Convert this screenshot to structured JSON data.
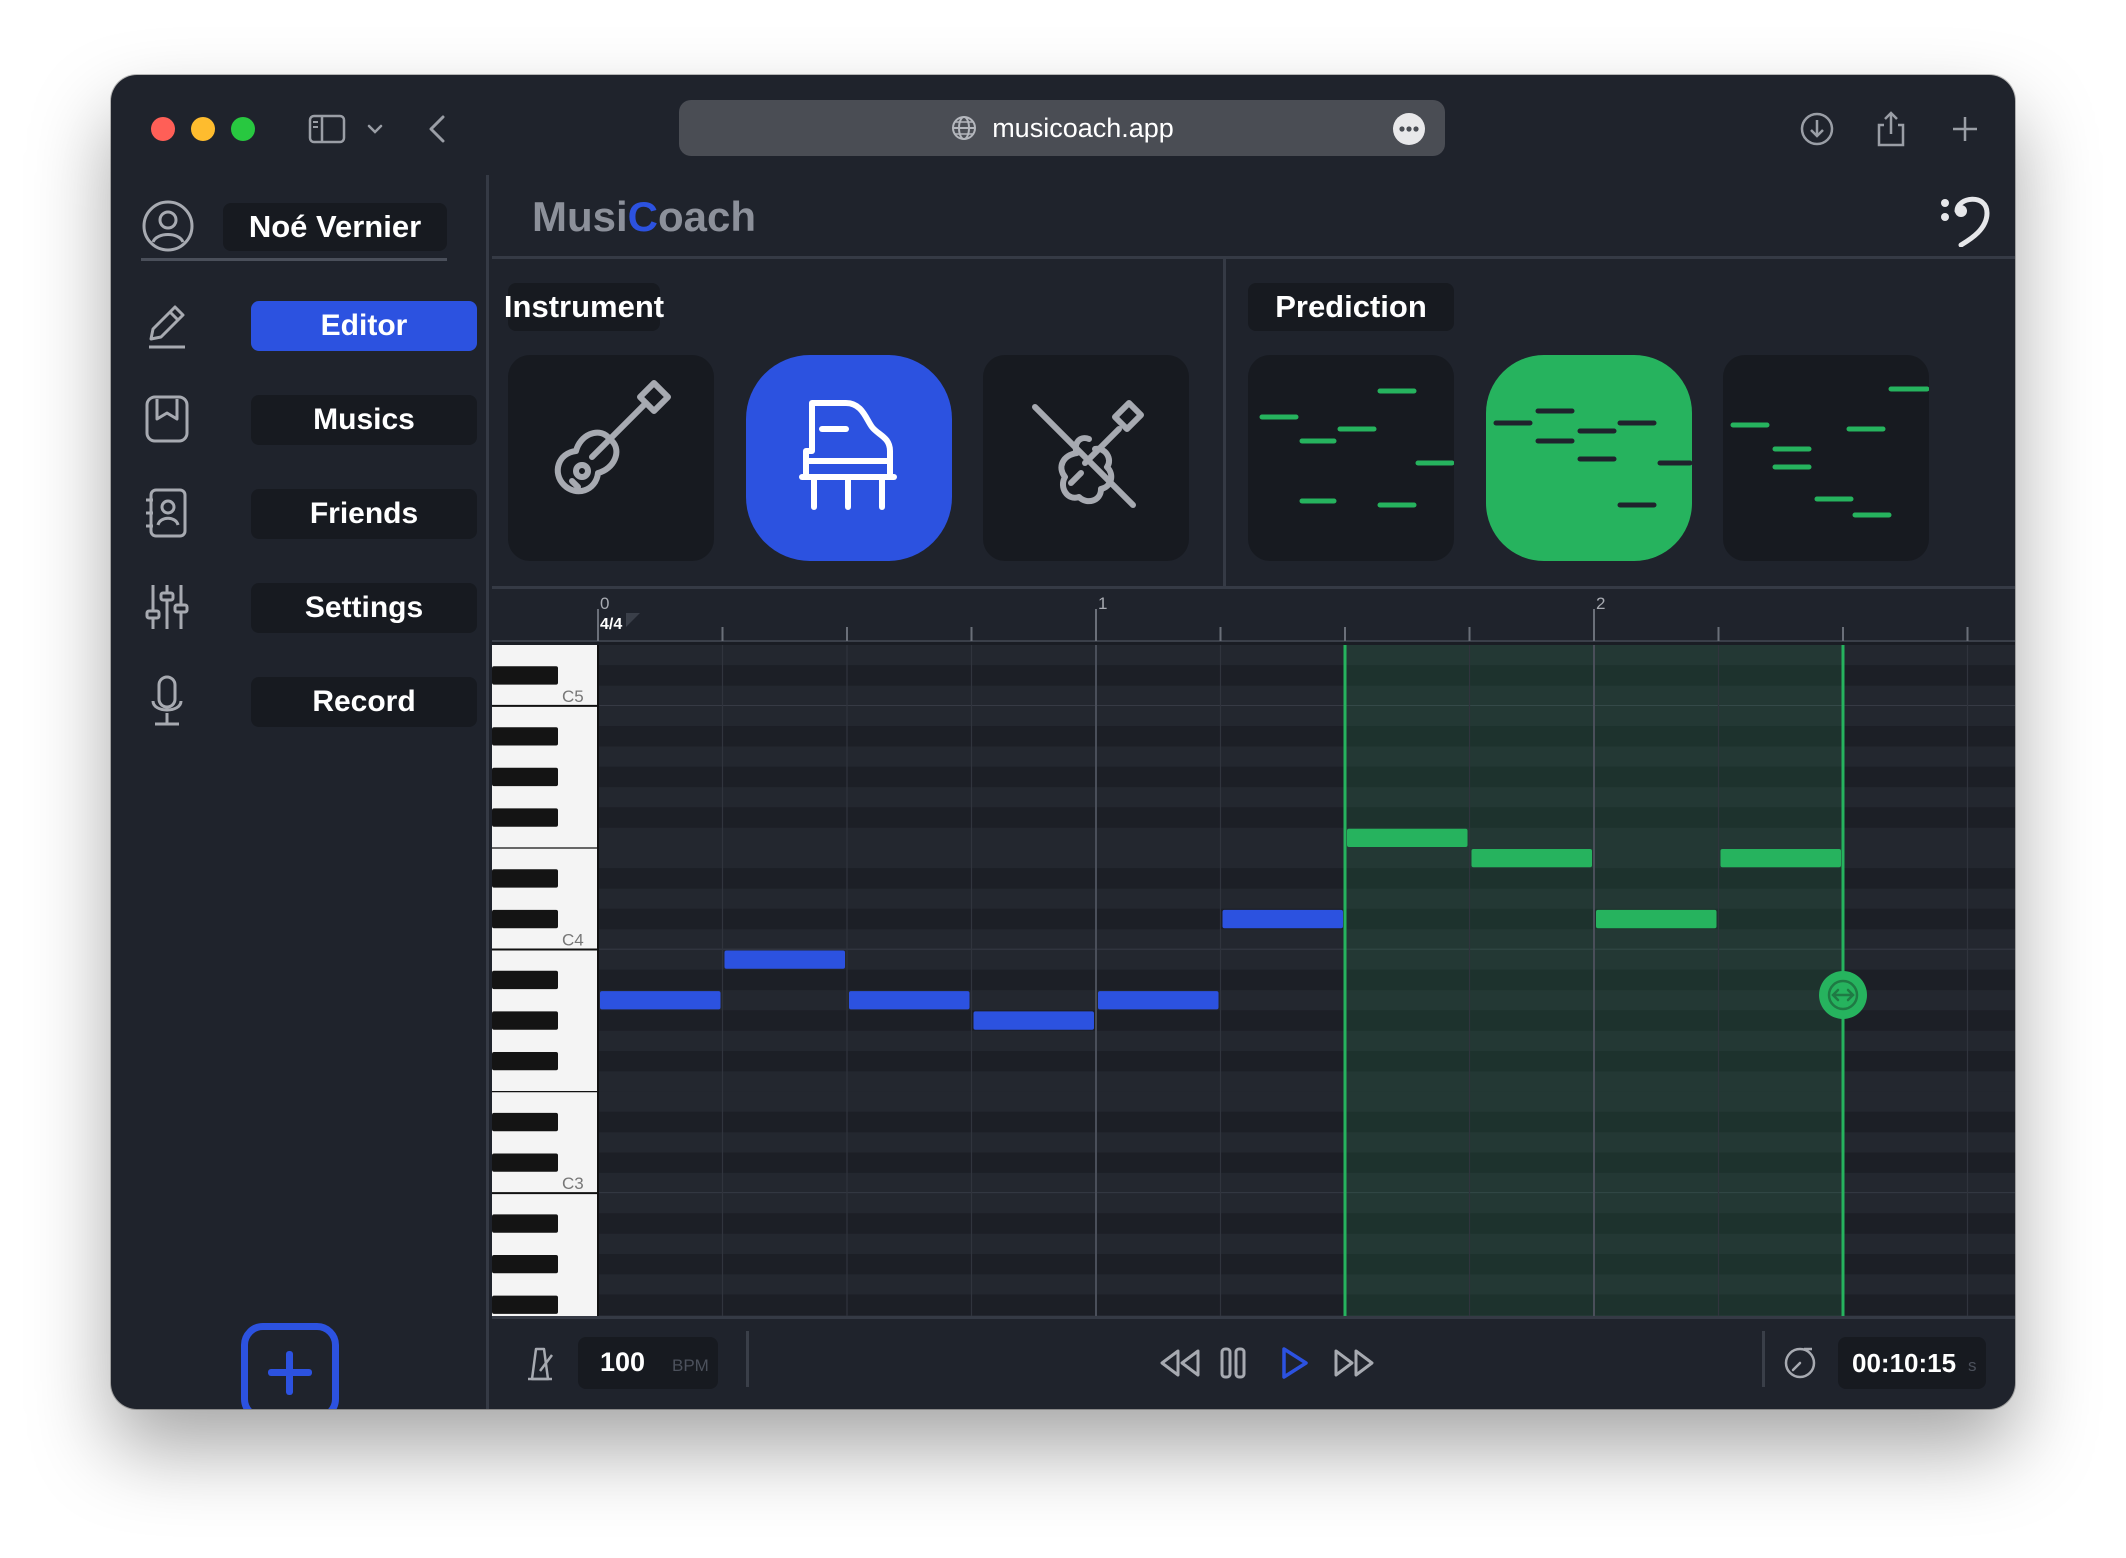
{
  "browser": {
    "url": "musicoach.app"
  },
  "user": {
    "name": "Noé Vernier"
  },
  "nav": [
    {
      "label": "Editor",
      "icon": "pencil-icon",
      "active": true
    },
    {
      "label": "Musics",
      "icon": "music-book-icon",
      "active": false
    },
    {
      "label": "Friends",
      "icon": "contacts-icon",
      "active": false
    },
    {
      "label": "Settings",
      "icon": "sliders-icon",
      "active": false
    },
    {
      "label": "Record",
      "icon": "microphone-icon",
      "active": false
    }
  ],
  "app": {
    "logo_part1": "Musi",
    "logo_part2": "C",
    "logo_part3": "oach"
  },
  "instrument": {
    "header": "Instrument",
    "options": [
      {
        "icon": "guitar-icon",
        "selected": false
      },
      {
        "icon": "piano-icon",
        "selected": true
      },
      {
        "icon": "violin-icon",
        "selected": false
      }
    ]
  },
  "prediction": {
    "header": "Prediction",
    "options": [
      {
        "icon": "prediction-pattern-1-icon",
        "selected": false
      },
      {
        "icon": "prediction-pattern-2-icon",
        "selected": true
      },
      {
        "icon": "prediction-pattern-3-icon",
        "selected": false
      }
    ]
  },
  "piano_roll": {
    "time_signature": "4/4",
    "bar_labels": [
      "0",
      "1",
      "2"
    ],
    "octave_labels": [
      "C5",
      "C4",
      "C3"
    ],
    "user_notes": [
      {
        "start": 0,
        "length": 1,
        "pitch": "A3"
      },
      {
        "start": 1,
        "length": 1,
        "pitch": "B3"
      },
      {
        "start": 2,
        "length": 1,
        "pitch": "A3"
      },
      {
        "start": 3,
        "length": 1,
        "pitch": "G#3"
      },
      {
        "start": 4,
        "length": 1,
        "pitch": "A3"
      },
      {
        "start": 5,
        "length": 1,
        "pitch": "C#4"
      }
    ],
    "predicted_notes": [
      {
        "start": 6,
        "length": 1,
        "pitch": "F4"
      },
      {
        "start": 7,
        "length": 1,
        "pitch": "E4"
      },
      {
        "start": 8,
        "length": 1,
        "pitch": "C#4"
      },
      {
        "start": 9,
        "length": 1,
        "pitch": "E4"
      }
    ],
    "prediction_region_beats": [
      6,
      10
    ],
    "colors": {
      "user": "#2c52e0",
      "prediction": "#26b35e"
    }
  },
  "transport": {
    "bpm": "100",
    "bpm_unit": "BPM",
    "time": "00:10:15",
    "time_unit": "s"
  }
}
